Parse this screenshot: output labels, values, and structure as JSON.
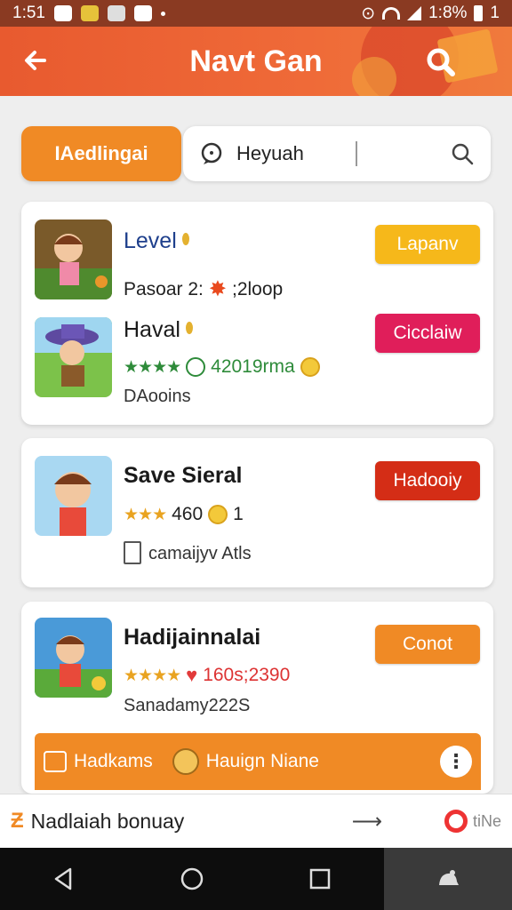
{
  "status_bar": {
    "time": "1:51",
    "battery": "1:8%",
    "extra": "1"
  },
  "app_bar": {
    "title": "Navt Gan"
  },
  "search": {
    "chip_label": "IAedlingai",
    "placeholder": "Heyuah"
  },
  "items": [
    {
      "name": "Level",
      "meta": "Pasoar 2:",
      "meta2": ";2loop",
      "button": "Lapanv",
      "button_color": "#f6b81a"
    },
    {
      "name": "Haval",
      "stars": "★★★★",
      "meta": "4201​9rma",
      "sub": "DAooins",
      "button": "Cicclaiw",
      "button_color": "#e01e5a"
    },
    {
      "name": "Save Sieral",
      "stars": "★★★",
      "meta": "460",
      "meta2": "1",
      "sub": "camaijyv Atls",
      "button": "Hadooiy",
      "button_color": "#d42d16"
    },
    {
      "name": "Hadijainnalai",
      "stars": "★★★★",
      "meta": "160s;2390",
      "sub": "Sanadamy222S",
      "button": "Conot",
      "button_color": "#f08a25"
    }
  ],
  "promo": {
    "left": "Hadkams",
    "right": "Hauign Niane"
  },
  "banner": {
    "text": "Nadlaiah bonuay",
    "right": "tiNe"
  },
  "colors": {
    "accent": "#f08a25",
    "appbar": "#e85a2f",
    "star_green": "#2e8b3a"
  }
}
